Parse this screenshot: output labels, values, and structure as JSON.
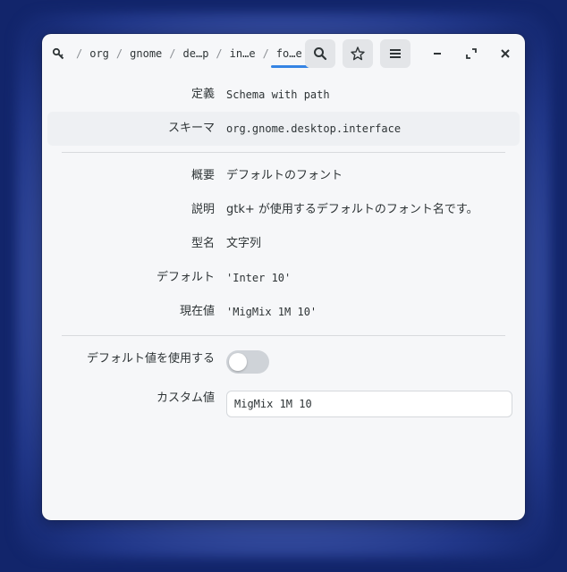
{
  "breadcrumb": {
    "root_icon": "dconf-root-icon",
    "separator": "/",
    "items": [
      "org",
      "gnome",
      "de…p",
      "in…e",
      "fo…e"
    ]
  },
  "header_buttons": {
    "search_icon": "search-icon",
    "bookmark_icon": "star-icon",
    "menu_icon": "hamburger-menu-icon",
    "minimize_icon": "minimize-icon",
    "maximize_icon": "maximize-icon",
    "close_icon": "close-icon"
  },
  "details": {
    "definition": {
      "label": "定義",
      "value": "Schema with path"
    },
    "schema": {
      "label": "スキーマ",
      "value": "org.gnome.desktop.interface"
    },
    "summary": {
      "label": "概要",
      "value": "デフォルトのフォント"
    },
    "description": {
      "label": "説明",
      "value": "gtk+ が使用するデフォルトのフォント名です。"
    },
    "type": {
      "label": "型名",
      "value": "文字列"
    },
    "default": {
      "label": "デフォルト",
      "value": "'Inter 10'"
    },
    "current": {
      "label": "現在値",
      "value": "'MigMix 1M 10'"
    }
  },
  "use_default": {
    "label": "デフォルト値を使用する",
    "enabled": false
  },
  "custom_value": {
    "label": "カスタム値",
    "value": "MigMix 1M 10"
  },
  "colors": {
    "accent": "#3584e4",
    "background": "#12256b",
    "window": "#f6f7f9"
  }
}
